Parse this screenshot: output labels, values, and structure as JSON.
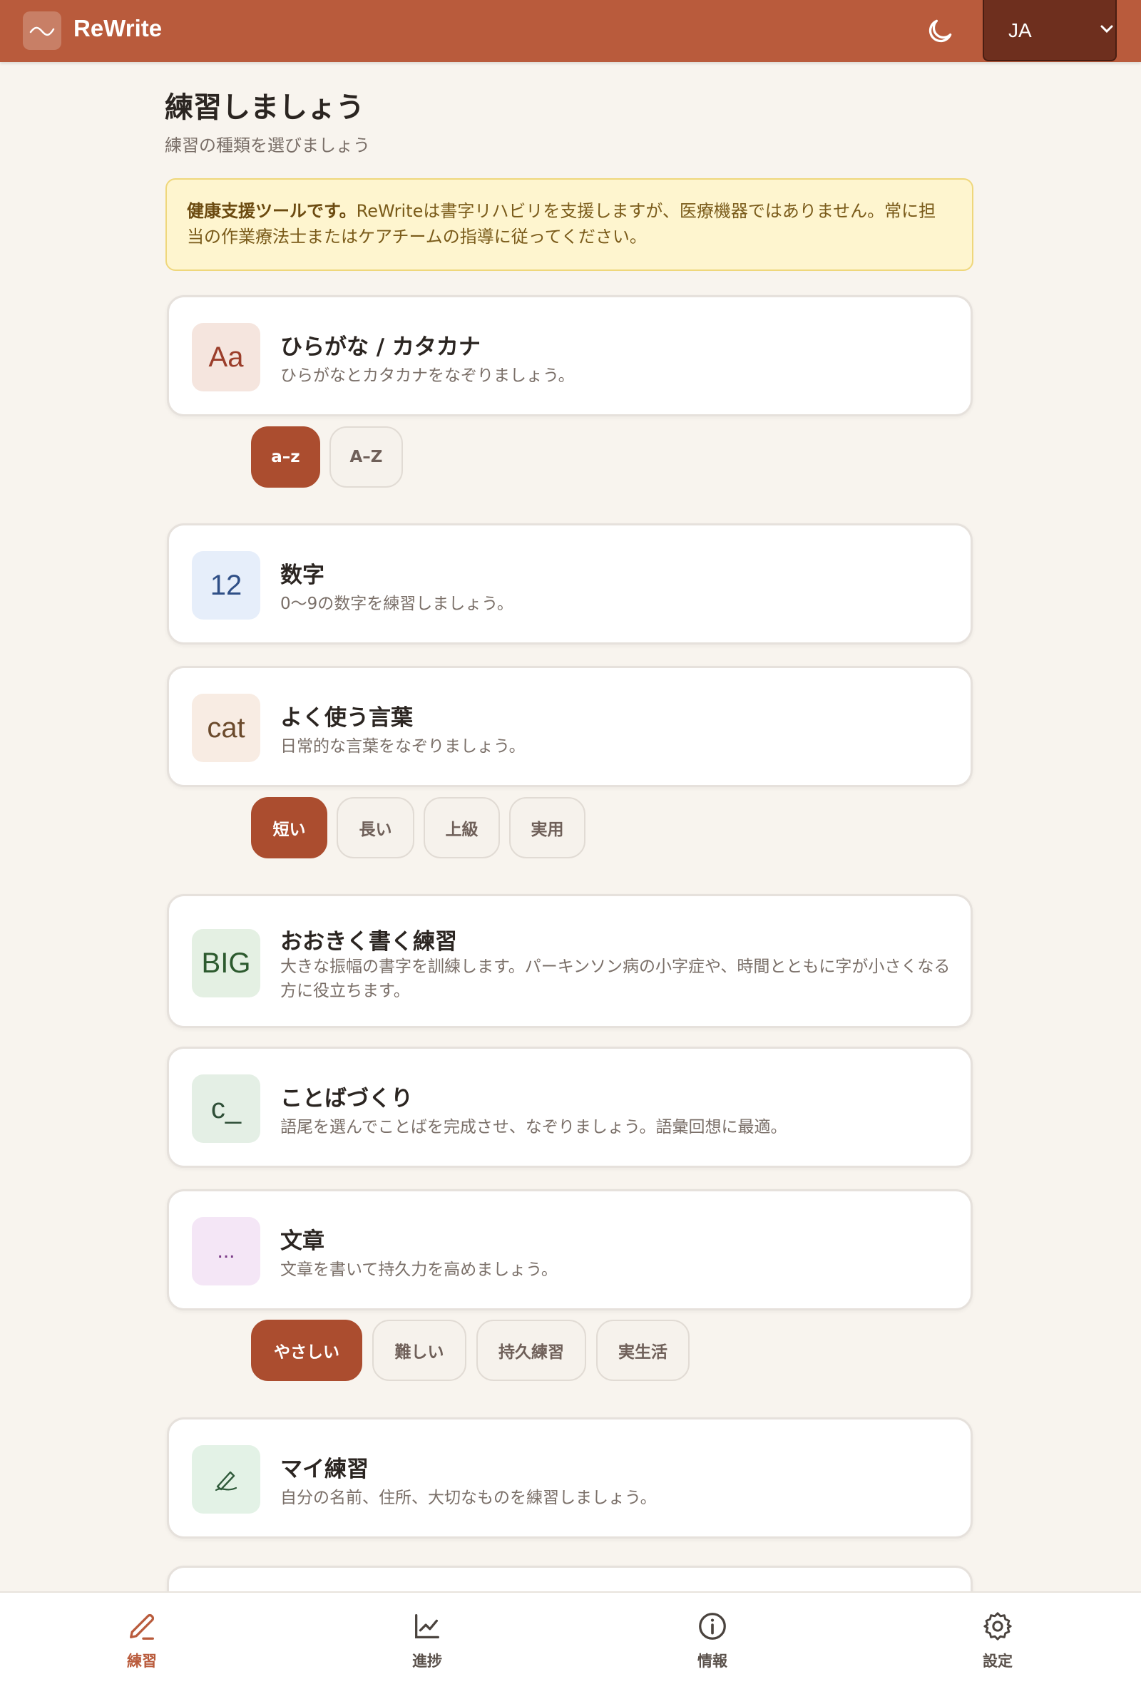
{
  "header": {
    "app_name": "ReWrite",
    "language": "JA"
  },
  "page": {
    "title": "練習しましょう",
    "subtitle": "練習の種類を選びましょう"
  },
  "notice": {
    "bold": "健康支援ツールです。",
    "text": "ReWriteは書字リハビリを支援しますが、医療機器ではありません。常に担当の作業療法士またはケアチームの指導に従ってください。"
  },
  "cards": [
    {
      "icon_text": "Aa",
      "title": "ひらがな / カタカナ",
      "desc": "ひらがなとカタカナをなぞりましょう。"
    },
    {
      "icon_text": "12",
      "title": "数字",
      "desc": "0〜9の数字を練習しましょう。"
    },
    {
      "icon_text": "cat",
      "title": "よく使う言葉",
      "desc": "日常的な言葉をなぞりましょう。"
    },
    {
      "icon_text": "BIG",
      "title": "おおきく書く練習",
      "desc": "大きな振幅の書字を訓練します。パーキンソン病の小字症や、時間とともに字が小さくなる方に役立ちます。"
    },
    {
      "icon_text": "c_",
      "title": "ことばづくり",
      "desc": "語尾を選んでことばを完成させ、なぞりましょう。語彙回想に最適。"
    },
    {
      "icon_text": "...",
      "title": "文章",
      "desc": "文章を書いて持久力を高めましょう。"
    },
    {
      "icon_name": "pen-writing-icon",
      "title": "マイ練習",
      "desc": "自分の名前、住所、大切なものを練習しましょう。"
    }
  ],
  "pills": {
    "kana": [
      "a–z",
      "A–Z"
    ],
    "words": [
      "短い",
      "長い",
      "上級",
      "実用"
    ],
    "sentences": [
      "やさしい",
      "難しい",
      "持久練習",
      "実生活"
    ]
  },
  "nav": [
    "練習",
    "進捗",
    "情報",
    "設定"
  ],
  "colors": {
    "accent": "#b95b3c",
    "active_pill": "#ab4d2f",
    "notice_bg": "#fef5cf"
  }
}
